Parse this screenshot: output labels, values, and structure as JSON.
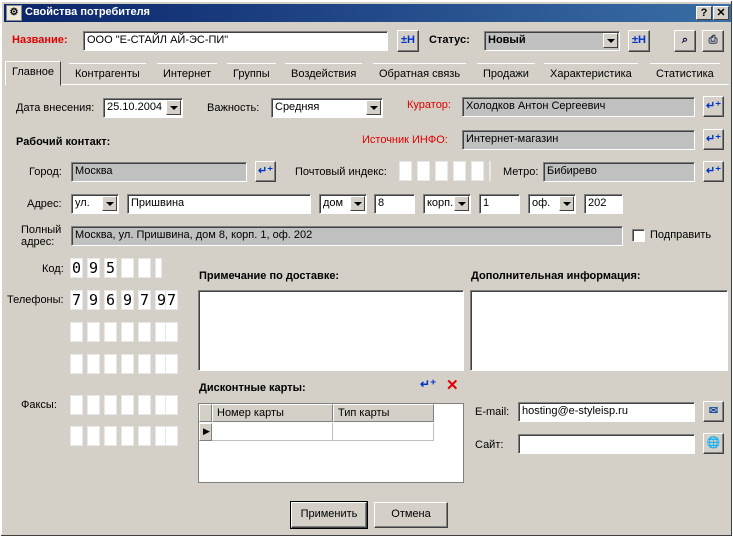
{
  "window": {
    "title": "Свойства потребителя",
    "help_btn": "?",
    "close_btn": "✕"
  },
  "header": {
    "name_label": "Название:",
    "name_value": "ООО \"Е-СТАЙЛ АЙ-ЭС-ПИ\"",
    "status_label": "Статус:",
    "status_value": "Новый"
  },
  "tabs": [
    "Главное",
    "Контрагенты",
    "Интернет",
    "Группы",
    "Воздействия",
    "Обратная связь",
    "Продажи",
    "Характеристика",
    "Статистика"
  ],
  "main": {
    "date_label": "Дата внесения:",
    "date_value": "25.10.2004",
    "importance_label": "Важность:",
    "importance_value": "Средняя",
    "curator_label": "Куратор:",
    "curator_value": "Холодков Антон Сергеевич",
    "work_contact_label": "Рабочий контакт:",
    "source_label": "Источник ИНФО:",
    "source_value": "Интернет-магазин",
    "city_label": "Город:",
    "city_value": "Москва",
    "postal_label": "Почтовый индекс:",
    "metro_label": "Метро:",
    "metro_value": "Бибирево",
    "address_label": "Адрес:",
    "street_type": "ул.",
    "street": "Пришвина",
    "house_type": "дом",
    "house": "8",
    "korp_type": "корп.",
    "korp": "1",
    "office_type": "оф.",
    "office": "202",
    "full_addr_label1": "Полный",
    "full_addr_label2": "адрес:",
    "full_addr_value": "Москва, ул. Пришвина, дом 8, корп. 1, оф. 202",
    "fix_label": "Подправить",
    "code_label": "Код:",
    "code_digits": [
      "0",
      "9",
      "5",
      "",
      ""
    ],
    "phones_label": "Телефоны:",
    "phone_digits": [
      "7",
      "9",
      "6",
      "9",
      "7",
      "9",
      "7"
    ],
    "faxes_label": "Факсы:",
    "delivery_label": "Примечание по доставке:",
    "extra_label": "Дополнительная информация:",
    "discount_label": "Дисконтные карты:",
    "discount_cols": [
      "Номер карты",
      "Тип карты"
    ],
    "email_label": "E-mail:",
    "email_value": "hosting@e-styleisp.ru",
    "site_label": "Сайт:",
    "site_value": ""
  },
  "footer": {
    "apply": "Применить",
    "cancel": "Отмена"
  }
}
